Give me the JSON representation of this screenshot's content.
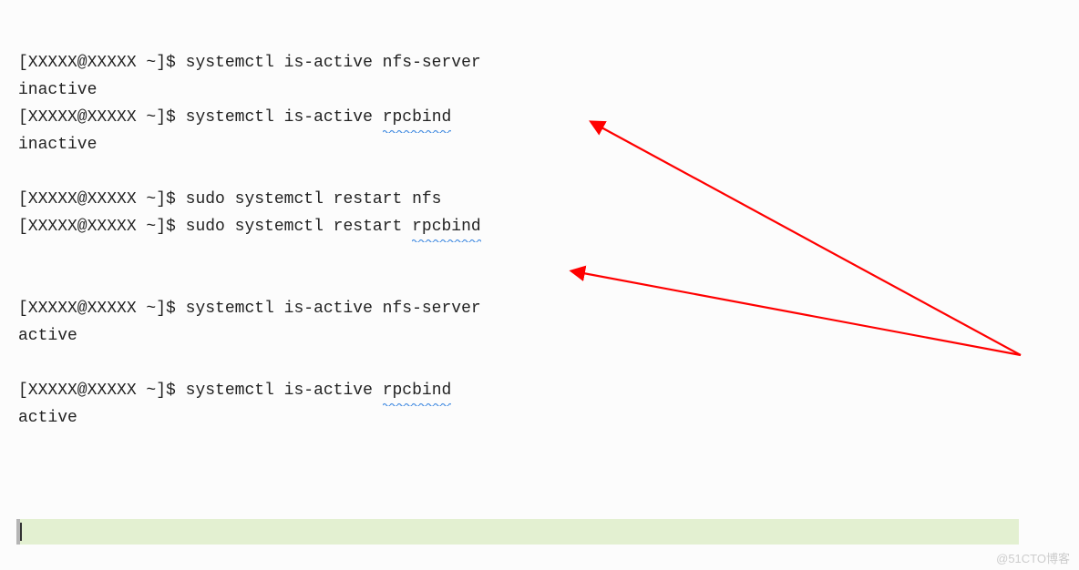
{
  "prompt": "[XXXXX@XXXXX ~]$ ",
  "lines": {
    "l1a": "systemctl is-active nfs-server",
    "l1b": "inactive",
    "l2a": "systemctl is-active ",
    "l2a_sq": "rpcbind",
    "l2b": "inactive",
    "l3a": "sudo systemctl restart nfs",
    "l4a": "sudo systemctl restart ",
    "l4a_sq": "rpcbind",
    "l5a": "systemctl is-active nfs-server",
    "l5b": "active",
    "l6a": "systemctl is-active ",
    "l6a_sq": "rpcbind",
    "l6b": "active"
  },
  "watermark": "@51CTO博客",
  "arrow_color": "#ff0000"
}
